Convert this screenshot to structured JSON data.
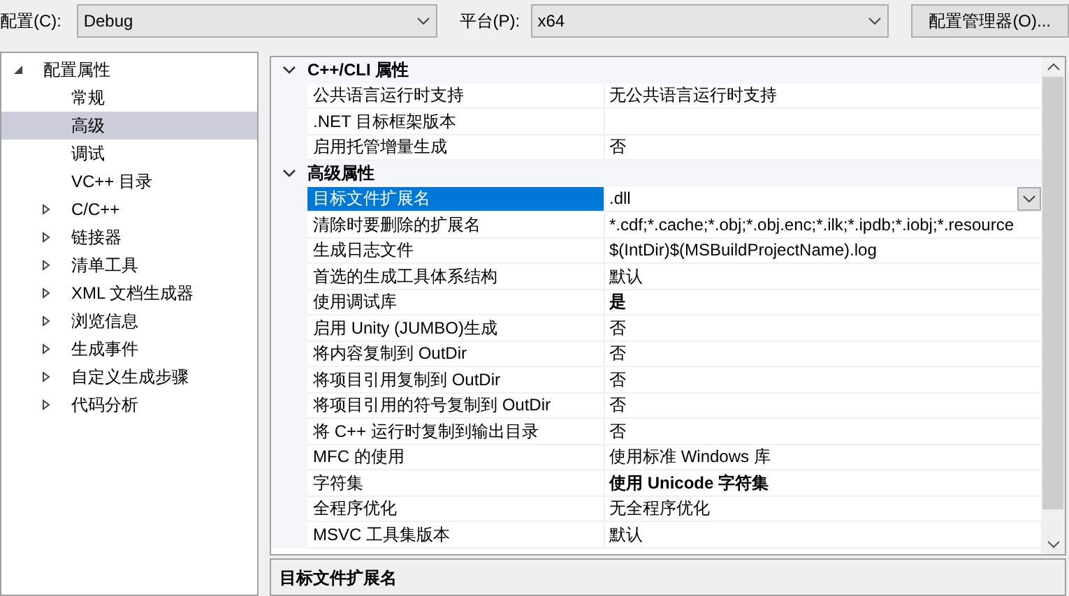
{
  "toolbar": {
    "config_label": "配置(C):",
    "config_value": "Debug",
    "platform_label": "平台(P):",
    "platform_value": "x64",
    "manager_button": "配置管理器(O)..."
  },
  "tree": [
    {
      "label": "配置属性",
      "expanded": true,
      "children": [
        {
          "label": "常规",
          "selected": false
        },
        {
          "label": "高级",
          "selected": true
        },
        {
          "label": "调试",
          "selected": false
        },
        {
          "label": "VC++ 目录",
          "selected": false
        },
        {
          "label": "C/C++",
          "selected": false,
          "expanded": false
        },
        {
          "label": "链接器",
          "selected": false,
          "expanded": false
        },
        {
          "label": "清单工具",
          "selected": false,
          "expanded": false
        },
        {
          "label": "XML 文档生成器",
          "selected": false,
          "expanded": false
        },
        {
          "label": "浏览信息",
          "selected": false,
          "expanded": false
        },
        {
          "label": "生成事件",
          "selected": false,
          "expanded": false
        },
        {
          "label": "自定义生成步骤",
          "selected": false,
          "expanded": false
        },
        {
          "label": "代码分析",
          "selected": false,
          "expanded": false
        }
      ]
    }
  ],
  "property_groups": [
    {
      "title": "C++/CLI 属性",
      "expanded": true,
      "rows": [
        {
          "name": "公共语言运行时支持",
          "value": "无公共语言运行时支持",
          "bold": false,
          "selected": false
        },
        {
          "name": ".NET 目标框架版本",
          "selected": false
        },
        {
          "name": "启用托管增量生成",
          "value": "否",
          "bold": false,
          "selected": false
        }
      ]
    },
    {
      "title": "高级属性",
      "expanded": true,
      "rows": [
        {
          "name": "目标文件扩展名",
          "value": ".dll",
          "bold": false,
          "selected": true
        },
        {
          "name": "清除时要删除的扩展名",
          "value": "*.cdf;*.cache;*.obj;*.obj.enc;*.ilk;*.ipdb;*.iobj;*.resource",
          "bold": false,
          "selected": false
        },
        {
          "name": "生成日志文件",
          "value": "$(IntDir)$(MSBuildProjectName).log",
          "bold": false,
          "selected": false
        },
        {
          "name": "首选的生成工具体系结构",
          "value": "默认",
          "bold": false,
          "selected": false
        },
        {
          "name": "使用调试库",
          "value": "是",
          "bold": true,
          "selected": false
        },
        {
          "name": "启用 Unity (JUMBO)生成",
          "value": "否",
          "bold": false,
          "selected": false
        },
        {
          "name": "将内容复制到 OutDir",
          "value": "否",
          "bold": false,
          "selected": false
        },
        {
          "name": "将项目引用复制到 OutDir",
          "value": "否",
          "bold": false,
          "selected": false
        },
        {
          "name": "将项目引用的符号复制到 OutDir",
          "value": "否",
          "bold": false,
          "selected": false
        },
        {
          "name": "将 C++ 运行时复制到输出目录",
          "value": "否",
          "bold": false,
          "selected": false
        },
        {
          "name": "MFC 的使用",
          "value": "使用标准 Windows 库",
          "bold": false,
          "selected": false
        },
        {
          "name": "字符集",
          "value": "使用 Unicode 字符集",
          "bold": true,
          "selected": false
        },
        {
          "name": "全程序优化",
          "value": "无全程序优化",
          "bold": false,
          "selected": false
        },
        {
          "name": "MSVC 工具集版本",
          "value": "默认",
          "bold": false,
          "selected": false
        }
      ]
    }
  ],
  "description": {
    "title": "目标文件扩展名"
  }
}
